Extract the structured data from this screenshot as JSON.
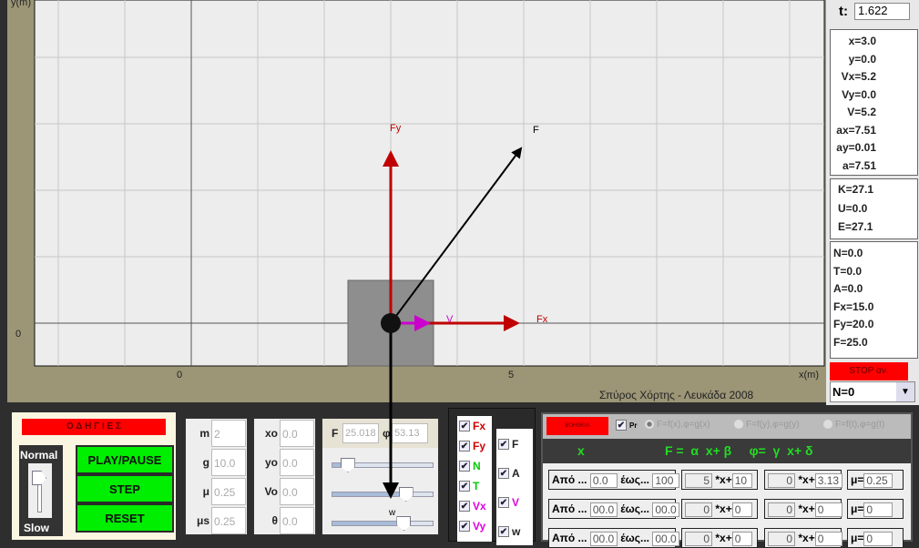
{
  "plot": {
    "y_axis_label": "y(m)",
    "x_axis_label": "x(m)",
    "x_ticks": [
      "0",
      "5"
    ],
    "y_ticks": [
      "0"
    ],
    "credit": "Σπύρος Χόρτης - Λευκάδα 2008",
    "vectors": {
      "Fy": "Fy",
      "F": "F",
      "Fx": "Fx",
      "V": "V",
      "w": "w"
    },
    "colors": {
      "force": "#c00000",
      "velocity": "#cc00cc",
      "resultant": "#000000"
    }
  },
  "side": {
    "t_label": "t:",
    "t_value": "1.622",
    "kinematics": [
      "x=3.0",
      "y=0.0",
      "Vx=5.2",
      "Vy=0.0",
      "V=5.2",
      "ax=7.51",
      "ay=0.01",
      "a=7.51"
    ],
    "energy": [
      "K=27.1",
      "U=0.0",
      "E=27.1"
    ],
    "forces": [
      "N=0.0",
      "T=0.0",
      "A=0.0",
      "Fx=15.0",
      "Fy=20.0",
      "F=25.0"
    ],
    "stop_label": "STOP αν.",
    "n_select": "N=0"
  },
  "controls": {
    "instructions": "Ο Δ Η Γ Ι Ε Σ",
    "speed_top": "Normal",
    "speed_bottom": "Slow",
    "speed_level": 0.9,
    "play": "PLAY/PAUSE",
    "step": "STEP",
    "reset": "RESET",
    "params1": [
      {
        "label": "m",
        "value": "2"
      },
      {
        "label": "g",
        "value": "10.0"
      },
      {
        "label": "μ",
        "value": "0.25"
      },
      {
        "label": "μs",
        "value": "0.25"
      }
    ],
    "params2": [
      {
        "label": "xo",
        "value": "0.0"
      },
      {
        "label": "yo",
        "value": "0.0"
      },
      {
        "label": "Vo",
        "value": "0.0"
      },
      {
        "label": "θ",
        "value": "0.0"
      }
    ],
    "F_label": "F",
    "F_value": "25.018",
    "phi_label": "φ",
    "phi_value": "53.13",
    "sliders": [
      0.15,
      0.72,
      0.7
    ]
  },
  "checks": {
    "col1": [
      {
        "label": "Fx",
        "color": "#d00000"
      },
      {
        "label": "Fy",
        "color": "#d00000"
      },
      {
        "label": "N",
        "color": "#00cc00"
      },
      {
        "label": "T",
        "color": "#00cc00"
      },
      {
        "label": "Vx",
        "color": "#dd00dd"
      },
      {
        "label": "Vy",
        "color": "#dd00dd"
      }
    ],
    "col2": [
      {
        "label": "F",
        "color": "#222"
      },
      {
        "label": "A",
        "color": "#222"
      },
      {
        "label": "V",
        "color": "#dd00dd"
      },
      {
        "label": "w",
        "color": "#222"
      }
    ]
  },
  "func": {
    "help": "ΒΟΗΘΕΙΑ",
    "pr": "Pr",
    "radios": [
      "F=f(x),φ=g(x)",
      "F=f(y),φ=g(y)",
      "F=f(t),φ=g(t)"
    ],
    "head_x": "x",
    "head_formula": "F =  α  x+ β     φ=  γ  x+ δ",
    "from": "Από ...",
    "to": "έως...",
    "xplus": "*x+",
    "mu": "μ=",
    "rows": [
      {
        "from": "0.0",
        "to": "100",
        "a": "5",
        "b": "10",
        "c": "0",
        "d": "3.13",
        "mu": "0.25"
      },
      {
        "from": "00.0",
        "to": "00.0",
        "a": "0",
        "b": "0",
        "c": "0",
        "d": "0",
        "mu": "0"
      },
      {
        "from": "00.0",
        "to": "00.0",
        "a": "0",
        "b": "0",
        "c": "0",
        "d": "0",
        "mu": "0"
      }
    ]
  }
}
